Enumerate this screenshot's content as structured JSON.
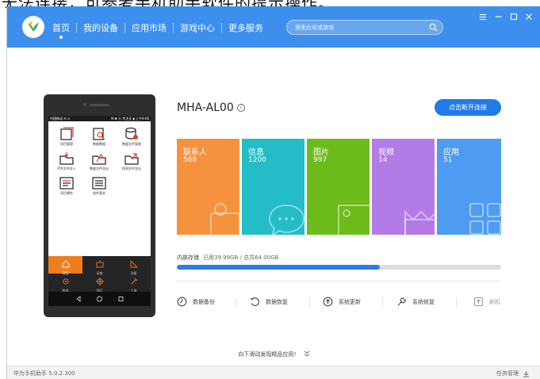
{
  "document": {
    "overlap_text": "无法连接，可参考手机助手软件的提示操作。"
  },
  "nav": {
    "items": [
      "首页",
      "我的设备",
      "应用市场",
      "游戏中心",
      "更多服务"
    ],
    "search_placeholder": "搜索应用或游戏",
    "active_index": 0
  },
  "phone_screen": {
    "status_left": "中国移动 ✉ ⊙",
    "status_right": "N ✱ ⓦ 专注无 ▮ 上午9:06",
    "apps": [
      "项目管理",
      "数据数据",
      "数据文件管理",
      "RTK文件导入",
      "数据文件导出",
      "探测文件导出",
      "项目属性",
      "软件基本"
    ],
    "dock": [
      "项目",
      "采集",
      "测量",
      "数据",
      "测区",
      "工具"
    ]
  },
  "device": {
    "name": "MHA-AL00",
    "disconnect_label": "点击断开连接"
  },
  "tiles": [
    {
      "title": "联系人",
      "count": "568",
      "color": "#f5923e"
    },
    {
      "title": "信息",
      "count": "1200",
      "color": "#24bcc6"
    },
    {
      "title": "图片",
      "count": "997",
      "color": "#6cbb1a"
    },
    {
      "title": "视频",
      "count": "14",
      "color": "#b27be8"
    },
    {
      "title": "应用",
      "count": "51",
      "color": "#4e9bf2"
    }
  ],
  "storage": {
    "label": "内部存储",
    "used_text": "已用39.99GB / 总共64.00GB",
    "used_fraction": 0.625
  },
  "tools": [
    "数据备份",
    "数据恢复",
    "系统更新",
    "系统修复",
    "刷机"
  ],
  "hint": "向下滑动发现精品应用！",
  "status": {
    "version": "华为手机助手 5.0.2.300",
    "task_label": "任务管理"
  },
  "colors": {
    "accent": "#3d8fee",
    "primary_button": "#1f7be8"
  }
}
